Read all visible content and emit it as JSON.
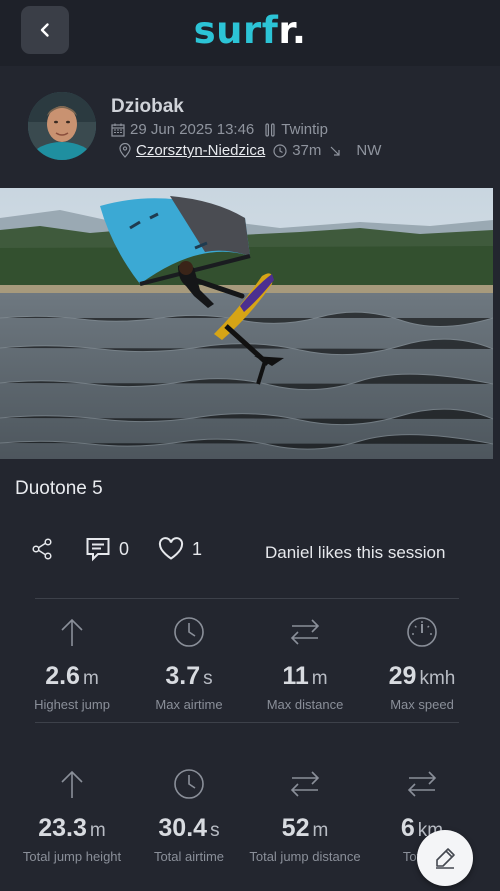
{
  "app": {
    "logo_part1": "surf",
    "logo_part2": "r."
  },
  "profile": {
    "username": "Dziobak",
    "date": "29 Jun 2025 13:46",
    "board": "Twintip",
    "spot": "Czorsztyn-Niedzica",
    "duration": "37m",
    "wind_direction": "NW"
  },
  "session": {
    "title": "Duotone 5"
  },
  "actions": {
    "comments_count": "0",
    "likes_count": "1",
    "likes_text": "Daniel likes this session"
  },
  "stats_top": [
    {
      "icon": "arrow-up-icon",
      "value": "2.6",
      "unit": "m",
      "label": "Highest jump"
    },
    {
      "icon": "clock-icon",
      "value": "3.7",
      "unit": "s",
      "label": "Max airtime"
    },
    {
      "icon": "arrows-exchange-icon",
      "value": "11",
      "unit": "m",
      "label": "Max distance"
    },
    {
      "icon": "speedometer-icon",
      "value": "29",
      "unit": "kmh",
      "label": "Max speed"
    }
  ],
  "stats_bottom": [
    {
      "icon": "arrow-up-icon",
      "value": "23.3",
      "unit": "m",
      "label": "Total jump height"
    },
    {
      "icon": "clock-icon",
      "value": "30.4",
      "unit": "s",
      "label": "Total airtime"
    },
    {
      "icon": "arrows-exchange-icon",
      "value": "52",
      "unit": "m",
      "label": "Total jump distance"
    },
    {
      "icon": "arrows-exchange-icon",
      "value": "6",
      "unit": "km",
      "label": "Total d"
    }
  ],
  "colors": {
    "background": "#23262f",
    "accent": "#2cc4d6"
  }
}
